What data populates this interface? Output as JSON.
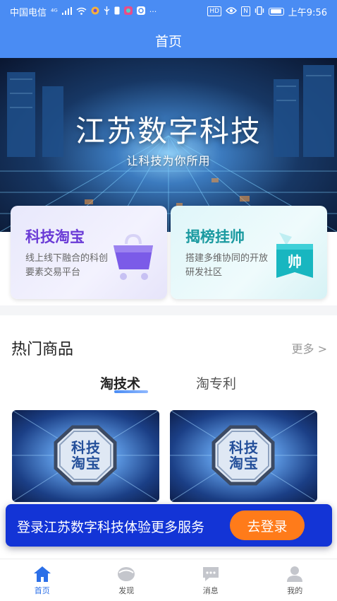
{
  "status_bar": {
    "carrier": "中国电信",
    "network": "⁴ᴳ",
    "hd": "HD",
    "nfc": "N",
    "time": "上午9:56"
  },
  "header": {
    "title": "首页"
  },
  "banner": {
    "title": "江苏数字科技",
    "subtitle": "让科技为你所用"
  },
  "cards": [
    {
      "title": "科技淘宝",
      "desc": "线上线下融合的科创要素交易平台",
      "icon": "shopping-cart-icon",
      "accent": "#6a3bd6"
    },
    {
      "title": "揭榜挂帅",
      "desc": "搭建多维协同的开放研发社区",
      "icon": "banner-flag-icon",
      "icon_text": "帅",
      "accent": "#1a9aa0"
    }
  ],
  "hot": {
    "title": "热门商品",
    "more": "更多 >",
    "tabs": [
      {
        "label": "淘技术",
        "active": true
      },
      {
        "label": "淘专利",
        "active": false
      }
    ],
    "products": [
      {
        "badge_line1": "科技",
        "badge_line2": "淘宝"
      },
      {
        "badge_line1": "科技",
        "badge_line2": "淘宝"
      }
    ]
  },
  "login_bar": {
    "text": "登录江苏数字科技体验更多服务",
    "button": "去登录",
    "bg": "#1334d6",
    "button_color": "#ff7b1a"
  },
  "nav": [
    {
      "label": "首页",
      "icon": "home-icon",
      "active": true
    },
    {
      "label": "发现",
      "icon": "discover-icon",
      "active": false
    },
    {
      "label": "消息",
      "icon": "message-icon",
      "active": false
    },
    {
      "label": "我的",
      "icon": "profile-icon",
      "active": false
    }
  ],
  "colors": {
    "primary": "#4a8cf3",
    "active_nav": "#2b6fe8"
  }
}
